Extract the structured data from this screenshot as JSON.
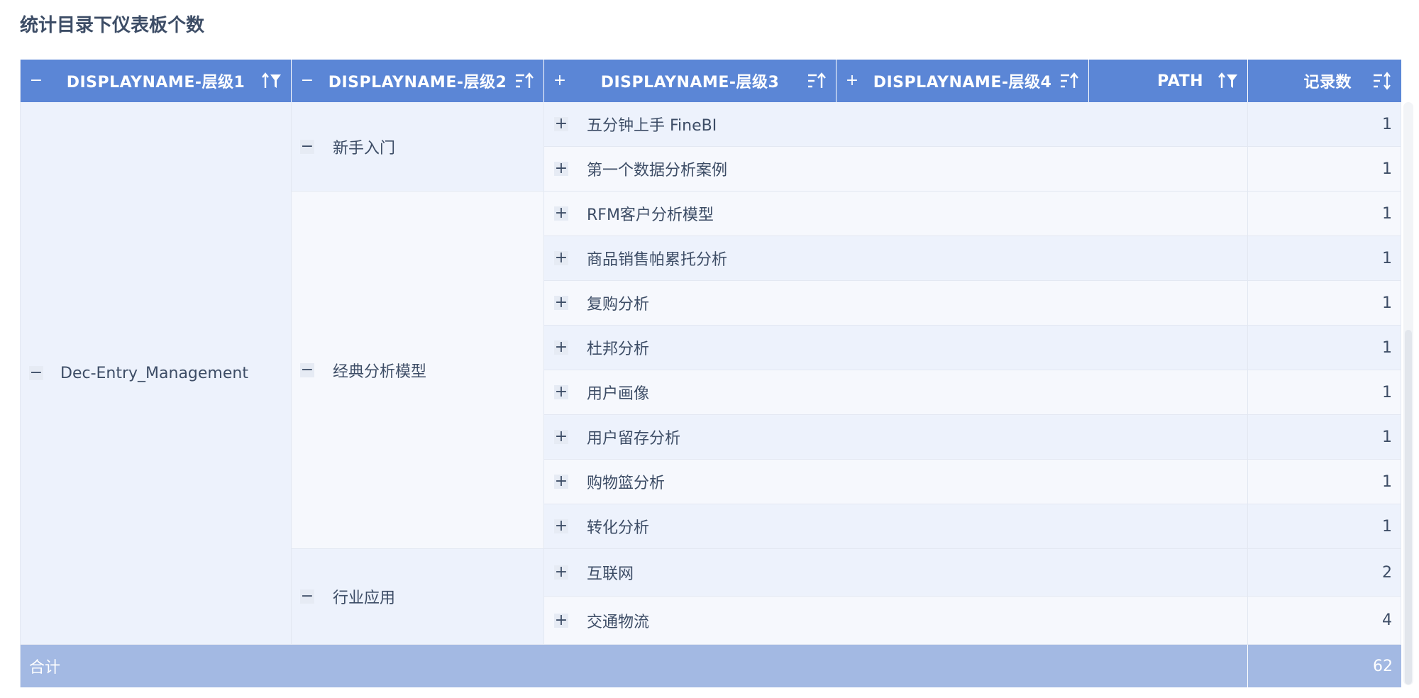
{
  "title": "统计目录下仪表板个数",
  "colors": {
    "header": "#5b86d6",
    "total": "#a3b9e3",
    "row_a": "#edf2fc",
    "row_b": "#f6f8fd"
  },
  "headers": [
    {
      "label": "DISPLAYNAME-层级1",
      "toggle": "−",
      "sort_icon": "sort-asc-filter-icon"
    },
    {
      "label": "DISPLAYNAME-层级2",
      "toggle": "−",
      "sort_icon": "sort-asc-icon"
    },
    {
      "label": "DISPLAYNAME-层级3",
      "toggle": "+",
      "sort_icon": "sort-asc-icon"
    },
    {
      "label": "DISPLAYNAME-层级4",
      "toggle": "+",
      "sort_icon": "sort-asc-icon"
    },
    {
      "label": "PATH",
      "toggle": "",
      "sort_icon": "sort-asc-filter-icon"
    },
    {
      "label": "记录数",
      "toggle": "",
      "sort_icon": "sort-both-icon"
    }
  ],
  "level1": {
    "label": "Dec-Entry_Management",
    "toggle": "−"
  },
  "level2": [
    {
      "label": "新手入门",
      "toggle": "−"
    },
    {
      "label": "经典分析模型",
      "toggle": "−"
    },
    {
      "label": "行业应用",
      "toggle": "−"
    }
  ],
  "rows": [
    {
      "label": "五分钟上手 FineBI",
      "toggle": "+",
      "count": "1"
    },
    {
      "label": "第一个数据分析案例",
      "toggle": "+",
      "count": "1"
    },
    {
      "label": "RFM客户分析模型",
      "toggle": "+",
      "count": "1"
    },
    {
      "label": "商品销售帕累托分析",
      "toggle": "+",
      "count": "1"
    },
    {
      "label": "复购分析",
      "toggle": "+",
      "count": "1"
    },
    {
      "label": "杜邦分析",
      "toggle": "+",
      "count": "1"
    },
    {
      "label": "用户画像",
      "toggle": "+",
      "count": "1"
    },
    {
      "label": "用户留存分析",
      "toggle": "+",
      "count": "1"
    },
    {
      "label": "购物篮分析",
      "toggle": "+",
      "count": "1"
    },
    {
      "label": "转化分析",
      "toggle": "+",
      "count": "1"
    },
    {
      "label": "互联网",
      "toggle": "+",
      "count": "2"
    },
    {
      "label": "交通物流",
      "toggle": "+",
      "count": "4"
    }
  ],
  "total": {
    "label": "合计",
    "count": "62"
  }
}
